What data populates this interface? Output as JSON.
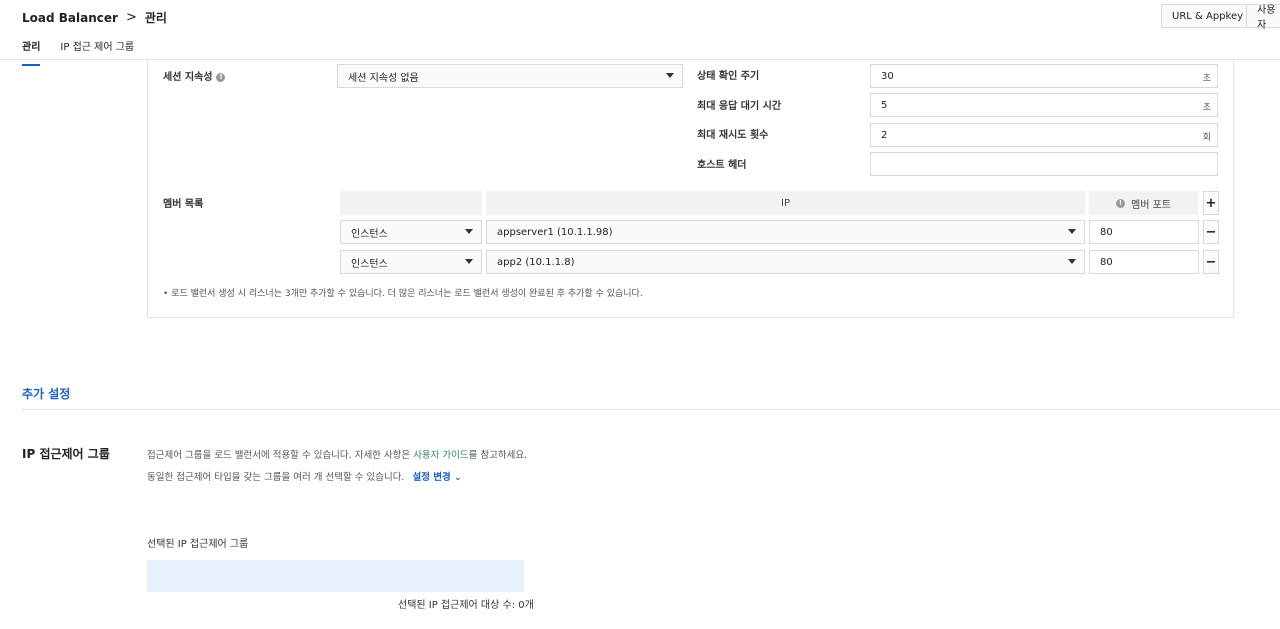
{
  "header": {
    "breadcrumb_service": "Load Balancer",
    "breadcrumb_sep": ">",
    "breadcrumb_page": "관리",
    "btn_url_appkey": "URL & Appkey",
    "btn_user": "사용자"
  },
  "tabs": [
    {
      "label": "관리",
      "active": true
    },
    {
      "label": "IP 접근 제어 그룹",
      "active": false
    }
  ],
  "session": {
    "label": "세션 지속성",
    "value": "세션 지속성 없음"
  },
  "health": {
    "interval_label": "상태 확인 주기",
    "interval_value": "30",
    "interval_unit": "초",
    "timeout_label": "최대 응답 대기 시간",
    "timeout_value": "5",
    "timeout_unit": "초",
    "retry_label": "최대 재시도 횟수",
    "retry_value": "2",
    "retry_unit": "회",
    "host_header_label": "호스트 헤더",
    "host_header_value": ""
  },
  "members": {
    "label": "멤버 목록",
    "col_ip": "IP",
    "col_port": "멤버 포트",
    "add_button": "+",
    "remove_button": "−",
    "rows": [
      {
        "type": "인스턴스",
        "ip": "appserver1 (10.1.1.98)",
        "port": "80"
      },
      {
        "type": "인스턴스",
        "ip": "app2 (10.1.1.8)",
        "port": "80"
      }
    ],
    "note": "• 로드 밸런서 생성 시 리스너는 3개만 추가할 수 있습니다. 더 많은 리스너는 로드 밸런서 생성이 완료된 후 추가할 수 있습니다."
  },
  "extra": {
    "title": "추가 설정",
    "ip_acl_title": "IP 접근제어 그룹",
    "desc1_pre": "접근제어 그룹을 로드 밸런서에 적용할 수 있습니다. 자세한 사항은 ",
    "desc1_link": "사용자 가이드",
    "desc1_post": "를 참고하세요.",
    "desc2": "동일한 접근제어 타입을 갖는 그룹을 여러 개 선택할 수 있습니다.",
    "change_link": "설정 변경",
    "chevron": "⌄",
    "selected_label": "선택된 IP 접근제어 그룹",
    "selected_count": "선택된 IP 접근제어 대상 수: 0개"
  }
}
